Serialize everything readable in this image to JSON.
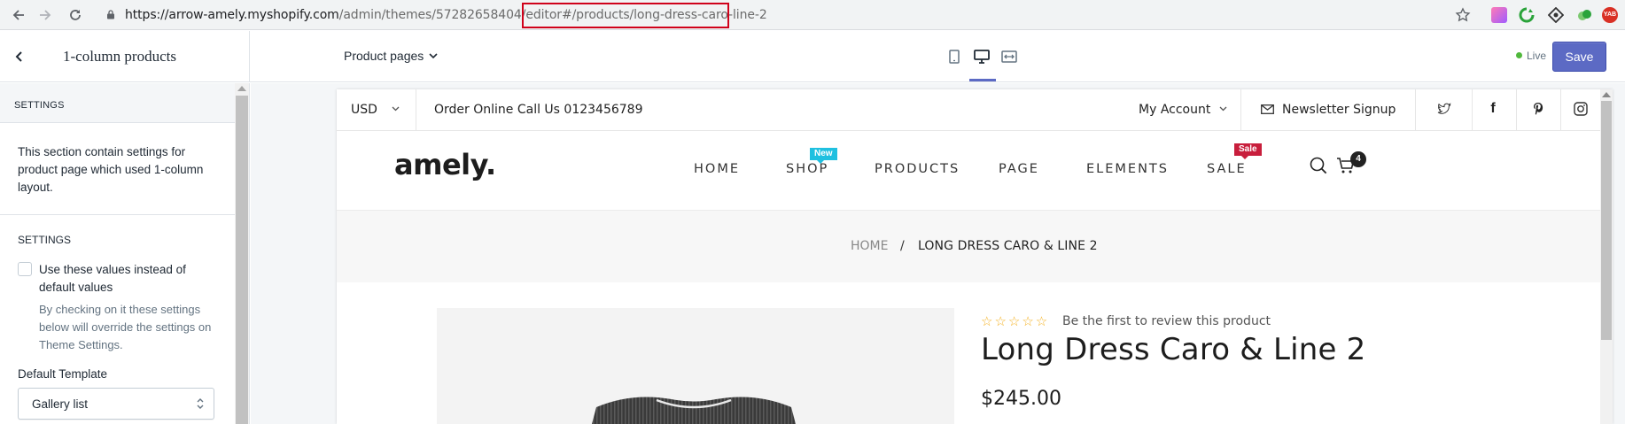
{
  "browser": {
    "url_host": "https://arrow-amely.myshopify.com",
    "url_path": "/admin/themes/57282658404/editor",
    "url_hash": "#/products/long-dress-caro-line-2"
  },
  "editor": {
    "section_title": "1-column products",
    "page_selector": "Product pages",
    "live_label": "Live",
    "save_label": "Save"
  },
  "sidebar": {
    "section_header": "SETTINGS",
    "description": "This section contain settings for product page which used 1-column layout.",
    "settings_label": "SETTINGS",
    "checkbox_label": "Use these values instead of default values",
    "checkbox_checked": false,
    "help_text": "By checking on it these settings below will override the settings on Theme Settings.",
    "template_label": "Default Template",
    "template_value": "Gallery list"
  },
  "store": {
    "currency": "USD",
    "order_text": "Order Online Call Us 0123456789",
    "my_account": "My Account",
    "newsletter": "Newsletter Signup",
    "logo": "amely.",
    "menu": [
      {
        "label": "HOME"
      },
      {
        "label": "SHOP",
        "badge": "New"
      },
      {
        "label": "PRODUCTS"
      },
      {
        "label": "PAGE"
      },
      {
        "label": "ELEMENTS"
      },
      {
        "label": "SALE",
        "badge": "Sale"
      }
    ],
    "cart_count": "4",
    "breadcrumb": {
      "home": "HOME",
      "separator": "/",
      "current": "LONG DRESS CARO & LINE 2"
    },
    "product": {
      "stars": "☆☆☆☆☆",
      "review_text": "Be the first to review this product",
      "title": "Long Dress Caro & Line 2",
      "price": "$245.00"
    }
  },
  "colors": {
    "accent": "#5c6ac4",
    "highlight_box": "#d0021b",
    "badge_new": "#1fc0e0",
    "badge_sale": "#c81e3c",
    "stars": "#f5b223",
    "live_dot": "#50b83c"
  }
}
